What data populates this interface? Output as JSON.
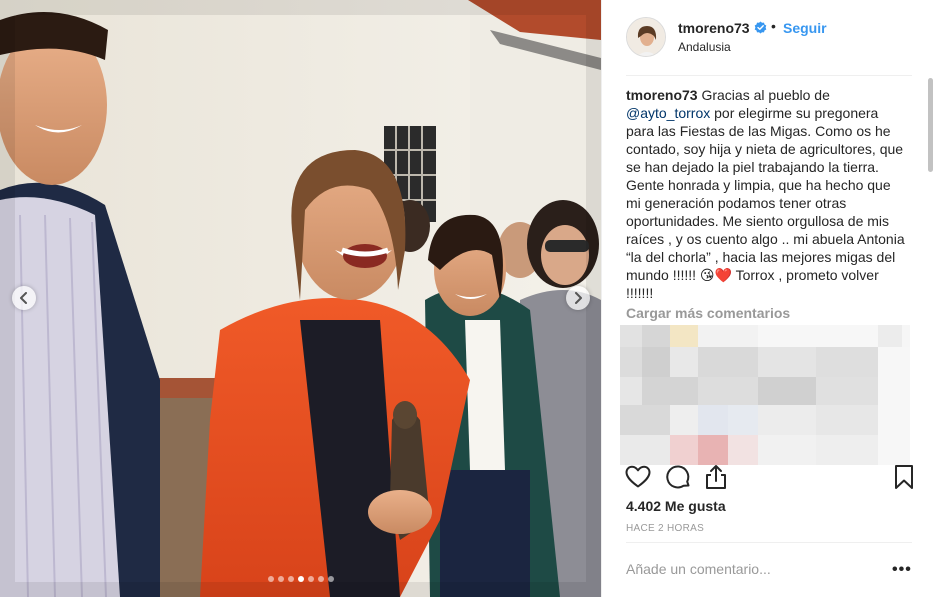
{
  "post": {
    "carousel": {
      "slide_count": 7,
      "active_slide": 4
    },
    "photo_icons": {
      "prev": "chevron-left-icon",
      "next": "chevron-right-icon"
    }
  },
  "header": {
    "username": "tmoreno73",
    "verified_icon": "verified-badge-icon",
    "separator": "•",
    "follow_label": "Seguir",
    "location": "Andalusia"
  },
  "caption": {
    "username": "tmoreno73",
    "text_before_mention": " Gracias al pueblo de ",
    "mention": "@ayto_torrox",
    "text_after_mention": " por elegirme su pregonera para las Fiestas de las Migas. Como os he contado, soy hija y nieta de agricultores, que se han dejado la piel trabajando la tierra. Gente honrada y limpia, que ha hecho que mi generación podamos tener otras oportunidades. Me siento orgullosa de mis raíces , y os cuento algo .. mi abuela Antonia “la del chorla” , hacia las mejores migas del mundo !!!!!! 😘❤️ Torrox , prometo volver !!!!!!!"
  },
  "comments": {
    "load_more_label": "Cargar más comentarios"
  },
  "actions": {
    "like_icon": "heart-icon",
    "comment_icon": "comment-icon",
    "share_icon": "share-icon",
    "save_icon": "bookmark-icon"
  },
  "likes_label": "4.402 Me gusta",
  "timestamp": "HACE 2 HORAS",
  "comment_box": {
    "placeholder": "Añade un comentario...",
    "more_label": "•••"
  },
  "colors": {
    "link_blue": "#3897f0",
    "mention_blue": "#003569",
    "secondary_text": "#999999",
    "primary_text": "#262626",
    "divider": "#efefef"
  }
}
